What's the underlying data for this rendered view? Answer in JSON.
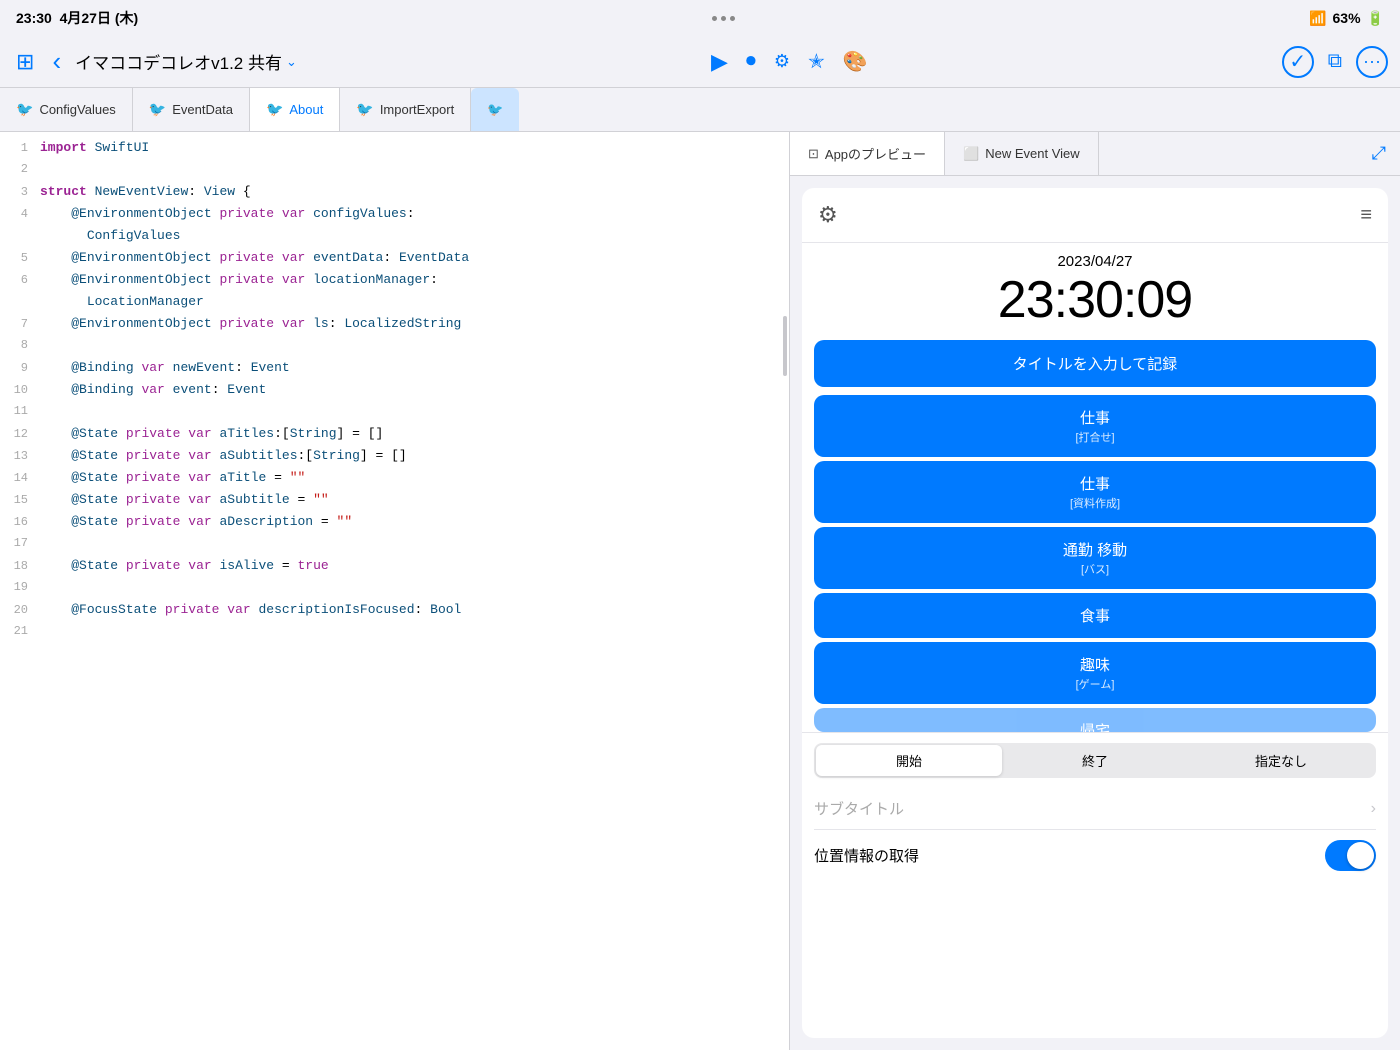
{
  "statusBar": {
    "time": "23:30",
    "date": "4月27日 (木)",
    "dots": 3,
    "battery": "63%",
    "wifiLabel": "wifi"
  },
  "toolbar": {
    "sidebarIcon": "⊞",
    "backIcon": "‹",
    "title": "イマココデコレオv1.2 共有",
    "chevron": "⌄",
    "playIcon": "▶",
    "recordIcon": "⏺",
    "adjustIcon": "⚙",
    "starIcon": "✭",
    "paintIcon": "🎨",
    "checkIcon": "✓",
    "copyIcon": "⧉",
    "moreIcon": "···"
  },
  "tabs": [
    {
      "id": "configvalues",
      "label": "ConfigValues",
      "active": false
    },
    {
      "id": "eventdata",
      "label": "EventData",
      "active": false
    },
    {
      "id": "about",
      "label": "About",
      "active": true
    },
    {
      "id": "importexport",
      "label": "ImportExport",
      "active": false
    }
  ],
  "codeLines": [
    {
      "num": 1,
      "content": "import SwiftUI"
    },
    {
      "num": 2,
      "content": ""
    },
    {
      "num": 3,
      "content": "struct NewEventView: View {"
    },
    {
      "num": 4,
      "content": "    @EnvironmentObject private var configValues:"
    },
    {
      "num": 4,
      "content": "      ConfigValues"
    },
    {
      "num": 5,
      "content": "    @EnvironmentObject private var eventData: EventData"
    },
    {
      "num": 6,
      "content": "    @EnvironmentObject private var locationManager:"
    },
    {
      "num": 6,
      "content": "      LocationManager"
    },
    {
      "num": 7,
      "content": "    @EnvironmentObject private var ls: LocalizedString"
    },
    {
      "num": 8,
      "content": ""
    },
    {
      "num": 9,
      "content": "    @Binding var newEvent: Event"
    },
    {
      "num": 10,
      "content": "    @Binding var event: Event"
    },
    {
      "num": 11,
      "content": ""
    },
    {
      "num": 12,
      "content": "    @State private var aTitles:[String] = []"
    },
    {
      "num": 13,
      "content": "    @State private var aSubtitles:[String] = []"
    },
    {
      "num": 14,
      "content": "    @State private var aTitle = \"\""
    },
    {
      "num": 15,
      "content": "    @State private var aSubtitle = \"\""
    },
    {
      "num": 16,
      "content": "    @State private var aDescription = \"\""
    },
    {
      "num": 17,
      "content": ""
    },
    {
      "num": 18,
      "content": "    @State private var isAlive = true"
    },
    {
      "num": 19,
      "content": ""
    },
    {
      "num": 20,
      "content": "    @FocusState private var descriptionIsFocused: Bool"
    },
    {
      "num": 21,
      "content": ""
    }
  ],
  "preview": {
    "tabs": [
      {
        "id": "app-preview",
        "label": "Appのプレビュー",
        "active": true
      },
      {
        "id": "new-event-view",
        "label": "New Event View",
        "active": false
      }
    ],
    "appDate": "2023/04/27",
    "appTime": "23:30:09",
    "titleInputPlaceholder": "タイトルを入力して記録",
    "buttons": [
      {
        "main": "仕事",
        "sub": "[打合せ]"
      },
      {
        "main": "仕事",
        "sub": "[資料作成]"
      },
      {
        "main": "通勤 移動",
        "sub": "[バス]"
      },
      {
        "main": "食事",
        "sub": null
      },
      {
        "main": "趣味",
        "sub": "[ゲーム]"
      },
      {
        "main": "帰宅",
        "sub": null
      }
    ],
    "segments": [
      "開始",
      "終了",
      "指定なし"
    ],
    "activeSegment": 0,
    "subtitlePlaceholder": "サブタイトル",
    "locationLabel": "位置情報の取得",
    "locationToggle": true
  }
}
